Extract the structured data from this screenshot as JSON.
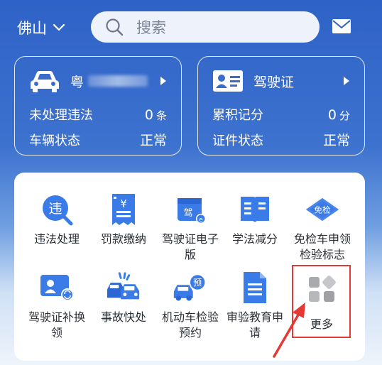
{
  "header": {
    "city": "佛山",
    "search_placeholder": "搜索",
    "icons": {
      "dropdown": "chevron-down-icon",
      "search": "search-icon",
      "mail": "mail-icon"
    }
  },
  "vehicle_card": {
    "plate_prefix": "粤",
    "icon": "car-icon",
    "rows": [
      {
        "label": "未处理违法",
        "value": "0",
        "unit": "条"
      },
      {
        "label": "车辆状态",
        "value": "正常",
        "unit": ""
      }
    ]
  },
  "license_card": {
    "title": "驾驶证",
    "icon": "id-card-icon",
    "rows": [
      {
        "label": "累积记分",
        "value": "0",
        "unit": "分"
      },
      {
        "label": "证件状态",
        "value": "正常",
        "unit": ""
      }
    ]
  },
  "services": [
    {
      "label": "违法处理",
      "icon": "violation-icon"
    },
    {
      "label": "罚款缴纳",
      "icon": "fine-receipt-icon"
    },
    {
      "label": "驾驶证电子版",
      "icon": "e-license-icon"
    },
    {
      "label": "学法减分",
      "icon": "book-icon"
    },
    {
      "label": "免检车申领检验标志",
      "icon": "exempt-badge-icon"
    },
    {
      "label": "驾驶证补换领",
      "icon": "license-renew-icon"
    },
    {
      "label": "事故快处",
      "icon": "accident-icon"
    },
    {
      "label": "机动车检验预约",
      "icon": "inspection-booking-icon"
    },
    {
      "label": "审验教育申请",
      "icon": "document-icon"
    },
    {
      "label": "更多",
      "icon": "more-grid-icon"
    }
  ],
  "colors": {
    "brand_blue": "#2f62c6",
    "icon_blue": "#3a7be8",
    "annotation_red": "#e53935"
  }
}
